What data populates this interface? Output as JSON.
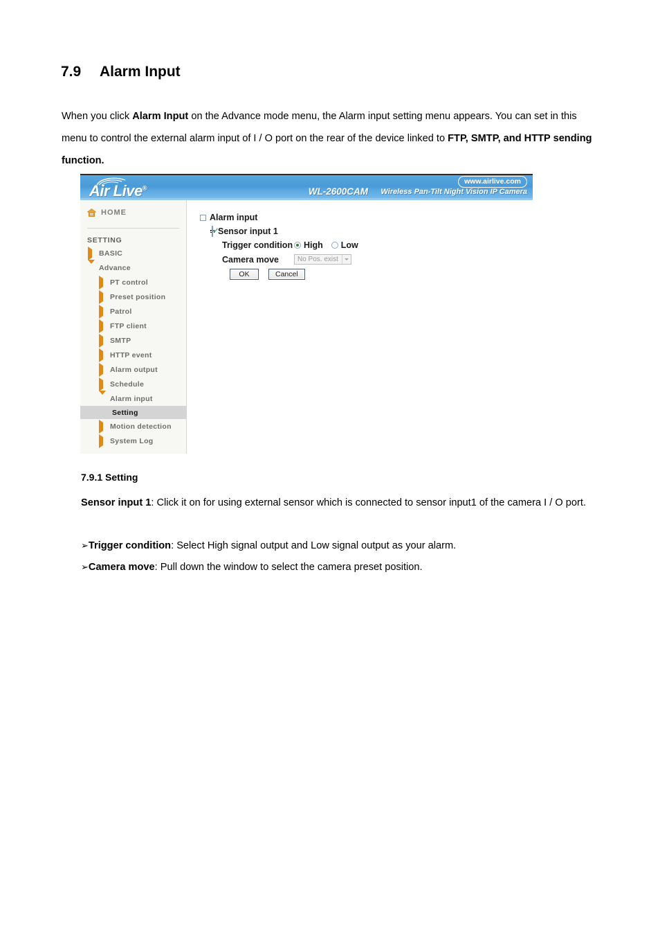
{
  "document": {
    "heading_number": "7.9",
    "heading_title": "Alarm Input",
    "intro_part1": "When you click ",
    "intro_bold1": "Alarm Input",
    "intro_part2": " on the Advance mode menu, the Alarm input setting menu appears. You can set in this menu to control the external alarm input of I / O port on the rear of the device linked to ",
    "intro_bold2": "FTP, SMTP, and HTTP sending function.",
    "sub_heading": "7.9.1 Setting",
    "p_sensor_bold": "Sensor input 1",
    "p_sensor_rest": ": Click it on for using external sensor which is connected to sensor input1 of the camera I / O port.",
    "bullet_glyph": "➢",
    "p_trigger_bold": "Trigger condition",
    "p_trigger_rest": ": Select High signal output and Low signal output as your alarm.",
    "p_camera_bold": "Camera move",
    "p_camera_rest": ": Pull down the window to select the camera preset position."
  },
  "screenshot": {
    "header": {
      "brand": "Air Live",
      "brand_reg": "®",
      "model": "WL-2600CAM",
      "tagline": "Wireless Pan-Tilt Night Vision IP Camera",
      "weburl": "www.airlive.com",
      "bg_color": "#4a9ad8"
    },
    "sidebar": {
      "home_label": "HOME",
      "setting_label": "SETTING",
      "items": [
        {
          "label": "BASIC",
          "level": 1,
          "state": "collapsed"
        },
        {
          "label": "Advance",
          "level": 1,
          "state": "expanded"
        },
        {
          "label": "PT control",
          "level": 2,
          "state": "collapsed"
        },
        {
          "label": "Preset position",
          "level": 2,
          "state": "collapsed"
        },
        {
          "label": "Patrol",
          "level": 2,
          "state": "collapsed"
        },
        {
          "label": "FTP client",
          "level": 2,
          "state": "collapsed"
        },
        {
          "label": "SMTP",
          "level": 2,
          "state": "collapsed"
        },
        {
          "label": "HTTP event",
          "level": 2,
          "state": "collapsed"
        },
        {
          "label": "Alarm output",
          "level": 2,
          "state": "collapsed"
        },
        {
          "label": "Schedule",
          "level": 2,
          "state": "collapsed"
        },
        {
          "label": "Alarm input",
          "level": 2,
          "state": "expanded"
        },
        {
          "label": "Setting",
          "level": 3,
          "state": "selected"
        },
        {
          "label": "Motion detection",
          "level": 2,
          "state": "collapsed"
        },
        {
          "label": "System Log",
          "level": 2,
          "state": "collapsed"
        }
      ],
      "accent_color": "#e08a15",
      "selected_bg": "#d4d4d4"
    },
    "form": {
      "group_label": "Alarm input",
      "group_checked": false,
      "sensor_label": "Sensor input 1",
      "sensor_checked": true,
      "trigger_label": "Trigger condition",
      "trigger_high": "High",
      "trigger_low": "Low",
      "trigger_selected": "High",
      "camera_label": "Camera move",
      "camera_value": "No Pos. exist",
      "camera_disabled": true,
      "ok_label": "OK",
      "cancel_label": "Cancel"
    }
  }
}
